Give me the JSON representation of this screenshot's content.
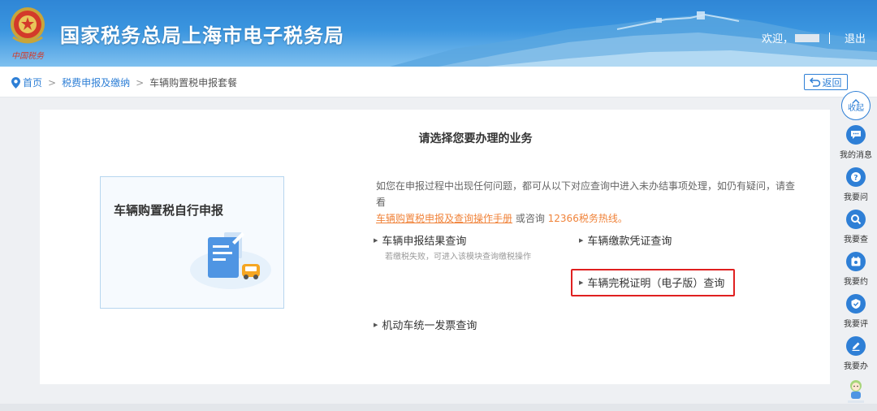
{
  "header": {
    "site_title": "国家税务总局上海市电子税务局",
    "emblem_caption": "中国税务",
    "welcome": "欢迎，",
    "logout": "退出"
  },
  "breadcrumb": {
    "home": "首页",
    "level2": "税费申报及缴纳",
    "current": "车辆购置税申报套餐",
    "separator": ">"
  },
  "back_button": "返回",
  "main": {
    "title": "请选择您要办理的业务",
    "tile_label": "车辆购置税自行申报",
    "notice_text": "如您在申报过程中出现任何问题，都可从以下对应查询中进入未办结事项处理，如仍有疑问，请查看",
    "notice_link": "车辆购置税申报及查询操作手册",
    "notice_mid": " 或咨询 ",
    "notice_hotline": "12366税务热线。",
    "options": {
      "declaration_result": "车辆申报结果查询",
      "declaration_result_hint": "若缴税失败，可进入该模块查询缴税操作",
      "payment_voucher": "车辆缴款凭证查询",
      "tax_certificate": "车辆完税证明（电子版）查询",
      "motor_invoice": "机动车统一发票查询"
    }
  },
  "sidebar": {
    "collapse": "收起",
    "tools": [
      {
        "label": "我的消息",
        "icon": "message-icon"
      },
      {
        "label": "我要问",
        "icon": "question-icon"
      },
      {
        "label": "我要查",
        "icon": "search-icon"
      },
      {
        "label": "我要约",
        "icon": "calendar-icon"
      },
      {
        "label": "我要评",
        "icon": "rating-icon"
      },
      {
        "label": "我要办",
        "icon": "edit-icon"
      }
    ]
  },
  "colors": {
    "primary": "#2e7fd6",
    "accent_orange": "#f0833a",
    "highlight_red": "#e02020"
  }
}
